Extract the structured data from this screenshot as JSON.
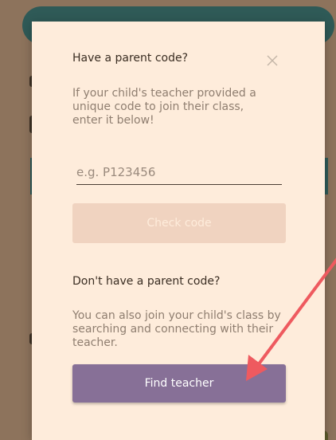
{
  "modal": {
    "title": "Have a parent code?",
    "description": "If your child's teacher provided a unique code to join their class, enter it below!",
    "code_input": {
      "value": "",
      "placeholder": "e.g. P123456"
    },
    "check_button_label": "Check code",
    "alt_title": "Don't have a parent code?",
    "alt_description": "You can also join your child's class by searching and connecting with their teacher.",
    "find_button_label": "Find teacher"
  },
  "icons": {
    "close": "close-icon"
  },
  "colors": {
    "modal_bg": "#feecdb",
    "primary_button": "#877097",
    "disabled_button": "#f0d3c0",
    "annotation_arrow": "#ee5a5f"
  }
}
